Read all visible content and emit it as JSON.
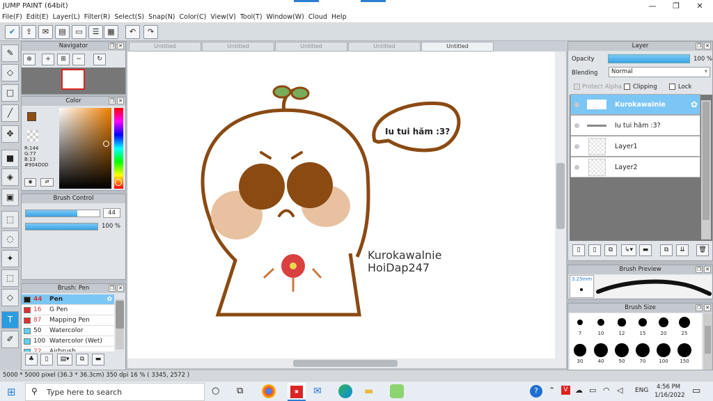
{
  "app": {
    "title": "JUMP PAINT (64bit)"
  },
  "menu": [
    "File(F)",
    "Edit(E)",
    "Layer(L)",
    "Filter(R)",
    "Select(S)",
    "Snap(N)",
    "Color(C)",
    "View(V)",
    "Tool(T)",
    "Window(W)",
    "Cloud",
    "Help"
  ],
  "tabs": [
    "Untitled",
    "Untitled",
    "Untitled",
    "Untitled",
    "Untitled"
  ],
  "navigator": {
    "title": "Navigator"
  },
  "color": {
    "title": "Color",
    "r": "R:144",
    "g": "G:77",
    "b": "B:13",
    "hex": "#904D0D",
    "primary": "#904D0D"
  },
  "brush_control": {
    "title": "Brush Control",
    "size": "44",
    "opacity": "100 %",
    "size_fill": 0.7,
    "opacity_fill": 1.0
  },
  "brush_list": {
    "title": "Brush: Pen",
    "items": [
      {
        "num": "44",
        "name": "Pen",
        "color": "#1a1a1a"
      },
      {
        "num": "16",
        "name": "G Pen",
        "color": "#e03030"
      },
      {
        "num": "87",
        "name": "Mapping Pen",
        "color": "#e03030"
      },
      {
        "num": "50",
        "name": "Watercolor",
        "color": "#60d0f0"
      },
      {
        "num": "100",
        "name": "Watercolor (Wet)",
        "color": "#60d0f0"
      },
      {
        "num": "22",
        "name": "Airbrush",
        "color": "#60d0f0"
      }
    ]
  },
  "layer": {
    "title": "Layer",
    "opacity_label": "Opacity",
    "opacity_value": "100 %",
    "blending_label": "Blending",
    "blending_value": "Normal",
    "protect_alpha": "Protect Alpha",
    "clipping": "Clipping",
    "lock": "Lock",
    "items": [
      {
        "name": "Kurokawalnie"
      },
      {
        "name": "Iu tui hăm :3?"
      },
      {
        "name": "Layer1"
      },
      {
        "name": "Layer2"
      }
    ]
  },
  "brush_preview": {
    "title": "Brush Preview",
    "size": "3.25mm"
  },
  "brush_size": {
    "title": "Brush Size",
    "row1": [
      "7",
      "10",
      "12",
      "15",
      "20",
      "25"
    ],
    "row2": [
      "30",
      "40",
      "50",
      "70",
      "100",
      "150"
    ]
  },
  "canvas": {
    "speech": "Iu tui hăm :3?",
    "sig1": "Kurokawalnie",
    "sig2": "HoiDap247"
  },
  "status": {
    "text": "5000 * 5000 pixel  (36.3 * 36.3cm)  350 dpi  16 %  ( 3345, 2572 )"
  },
  "taskbar": {
    "search": "Type here to search",
    "time": "4:56 PM",
    "date": "1/16/2022",
    "lang": "ENG"
  }
}
